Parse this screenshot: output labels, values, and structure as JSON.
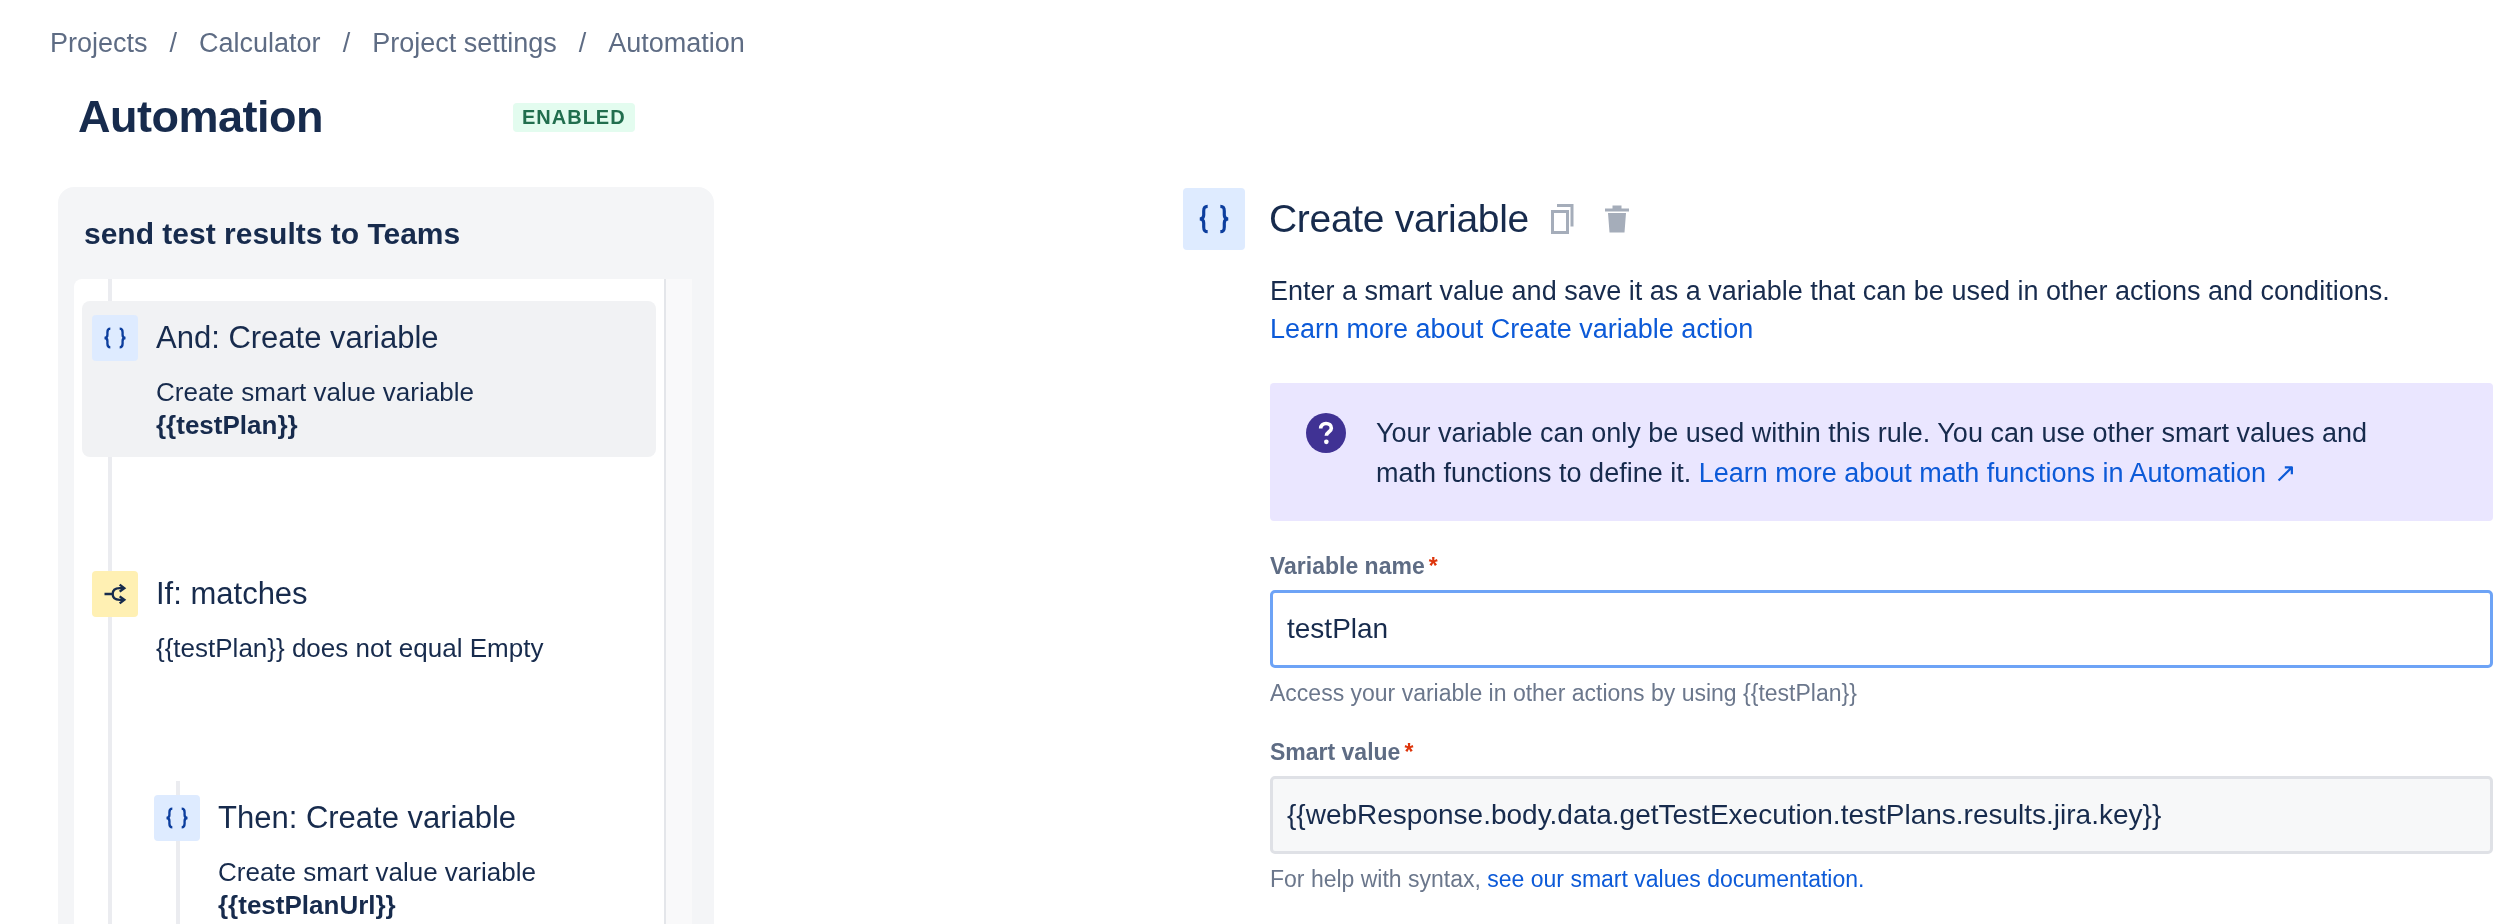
{
  "breadcrumbs": [
    {
      "text": "Projects"
    },
    {
      "separator": "/",
      "text": "Calculator"
    },
    {
      "separator": "/",
      "text": "Project settings"
    },
    {
      "separator": "/",
      "text": "Automation"
    }
  ],
  "page": {
    "title": "Automation",
    "status": "ENABLED"
  },
  "rule": {
    "title": "send test results to Teams",
    "steps": [
      {
        "kind": "variable",
        "selected": true,
        "title": "And: Create variable",
        "description": "Create smart value variable",
        "value": "{{testPlan}}"
      },
      {
        "kind": "condition",
        "selected": false,
        "title": "If: matches",
        "description": "{{testPlan}} does not equal Empty",
        "children": [
          {
            "kind": "variable",
            "selected": false,
            "title": "Then: Create variable",
            "description": "Create smart value variable",
            "value": "{{testPlanUrl}}"
          }
        ]
      }
    ]
  },
  "editor": {
    "kind": "variable",
    "title": "Create variable",
    "description": "Enter a smart value and save it as a variable that can be used in other actions and conditions.",
    "learn_link": "Learn more about Create variable action",
    "info": {
      "text": "Your variable can only be used within this rule. You can use other smart values and math functions to define it.",
      "link": "Learn more about math functions in Automation ↗"
    },
    "fields": [
      {
        "label": "Variable name",
        "required_mark": "*",
        "focused": true,
        "value": "testPlan",
        "help": "Access your variable in other actions by using {{testPlan}}"
      },
      {
        "label": "Smart value",
        "required_mark": "*",
        "focused": false,
        "value": "{{webResponse.body.data.getTestExecution.testPlans.results.jira.key}}",
        "help": "For help with syntax,",
        "help_link": "see our smart values documentation."
      }
    ]
  }
}
